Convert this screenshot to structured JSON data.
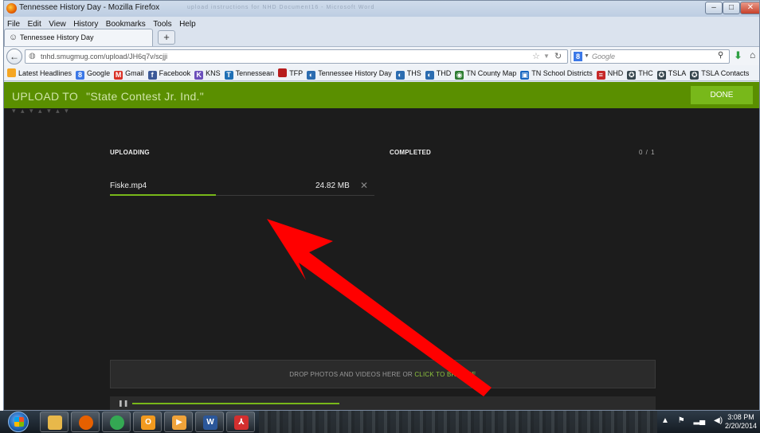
{
  "window": {
    "title": "Tennessee History Day - Mozilla Firefox",
    "controls": {
      "minimize": "–",
      "maximize": "□",
      "close": "✕"
    },
    "ghost_text": "upload instructions for NHD Document16 - Microsoft Word"
  },
  "menu": [
    "File",
    "Edit",
    "View",
    "History",
    "Bookmarks",
    "Tools",
    "Help"
  ],
  "tab": {
    "label": "Tennessee History Day",
    "icon": "smiley-icon",
    "new_tab": "+"
  },
  "nav": {
    "url": "tnhd.smugmug.com/upload/JH6q7v/scjji",
    "search_placeholder": "Google",
    "search_engine_letter": "8"
  },
  "bookmarks": [
    {
      "label": "Latest Headlines",
      "icon": "rss-icon",
      "color": "#f5a623",
      "glyph": ""
    },
    {
      "label": "Google",
      "icon": "google-icon",
      "color": "#3b78e7",
      "glyph": "8"
    },
    {
      "label": "Gmail",
      "icon": "gmail-icon",
      "color": "#d93025",
      "glyph": "M"
    },
    {
      "label": "Facebook",
      "icon": "facebook-icon",
      "color": "#3b5998",
      "glyph": "f"
    },
    {
      "label": "KNS",
      "icon": "kns-icon",
      "color": "#6b4fbb",
      "glyph": "K"
    },
    {
      "label": "Tennessean",
      "icon": "tennessean-icon",
      "color": "#1f6fb5",
      "glyph": "T"
    },
    {
      "label": "TFP",
      "icon": "tfp-icon",
      "color": "#b71c1c",
      "glyph": ""
    },
    {
      "label": "Tennessee History Day",
      "icon": "globe-icon",
      "color": "#2b6cb0",
      "glyph": "◐"
    },
    {
      "label": "THS",
      "icon": "globe-icon",
      "color": "#2b6cb0",
      "glyph": "◐"
    },
    {
      "label": "THD",
      "icon": "globe-icon",
      "color": "#2b6cb0",
      "glyph": "◐"
    },
    {
      "label": "TN County Map",
      "icon": "map-icon",
      "color": "#2e7d32",
      "glyph": "◉"
    },
    {
      "label": "TN School Districts",
      "icon": "school-icon",
      "color": "#1565c0",
      "glyph": "▣"
    },
    {
      "label": "NHD",
      "icon": "nhd-icon",
      "color": "#c62828",
      "glyph": "≡"
    },
    {
      "label": "THC",
      "icon": "thc-icon",
      "color": "#37474f",
      "glyph": "✪"
    },
    {
      "label": "TSLA",
      "icon": "tsla-icon",
      "color": "#37474f",
      "glyph": "✪"
    },
    {
      "label": "TSLA Contacts",
      "icon": "tsla-icon",
      "color": "#37474f",
      "glyph": "✪"
    }
  ],
  "header": {
    "upload_to_label": "UPLOAD TO",
    "gallery_name": "\"State Contest Jr. Ind.\"",
    "done_button": "DONE"
  },
  "upload": {
    "uploading_heading": "UPLOADING",
    "completed_heading": "COMPLETED",
    "completed_count": "0 / 1",
    "file": {
      "name": "Fiske.mp4",
      "size": "24.82 MB",
      "remove_glyph": "✕",
      "progress": 0.4
    },
    "bottom_progress": 0.38,
    "dropzone": {
      "text": "DROP PHOTOS AND VIDEOS HERE OR ",
      "link": "CLICK TO BROWSE"
    }
  },
  "annotation": {
    "arrow_color": "#ff0000"
  },
  "taskbar": {
    "apps": [
      {
        "name": "explorer",
        "icon": "folder-icon",
        "glyph": "",
        "color": "#e8b84a"
      },
      {
        "name": "firefox",
        "icon": "firefox-icon",
        "glyph": "",
        "color": "#e66000"
      },
      {
        "name": "chrome",
        "icon": "chrome-icon",
        "glyph": "",
        "color": "#34a853"
      },
      {
        "name": "outlook",
        "icon": "outlook-icon",
        "glyph": "O",
        "color": "#f29a1f"
      },
      {
        "name": "media",
        "icon": "media-player-icon",
        "glyph": "▶",
        "color": "#f0a33a"
      },
      {
        "name": "word",
        "icon": "word-icon",
        "glyph": "W",
        "color": "#2b579a"
      },
      {
        "name": "acrobat",
        "icon": "acrobat-icon",
        "glyph": "⅄",
        "color": "#d32f2f"
      }
    ],
    "tray": [
      "▲",
      "⚑",
      "▂▄",
      "◀)"
    ],
    "time": "3:08 PM",
    "date": "2/20/2014"
  }
}
